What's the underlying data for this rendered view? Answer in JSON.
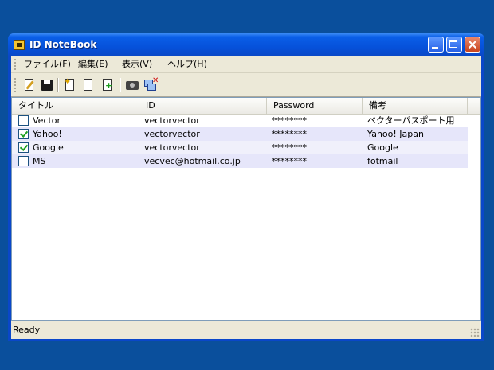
{
  "window": {
    "title": "ID NoteBook"
  },
  "menu": {
    "items": [
      {
        "label": "ファイル(F)"
      },
      {
        "label": "編集(E)"
      },
      {
        "label": "表示(V)"
      },
      {
        "label": "ヘルプ(H)"
      }
    ]
  },
  "toolbar": {
    "buttons": [
      {
        "icon": "edit-icon"
      },
      {
        "icon": "save-icon"
      },
      {
        "icon": "new-item-icon"
      },
      {
        "icon": "new-page-icon"
      },
      {
        "icon": "add-icon"
      },
      {
        "icon": "capture-icon"
      },
      {
        "icon": "delete-window-icon"
      }
    ]
  },
  "table": {
    "columns": [
      "タイトル",
      "ID",
      "Password",
      "備考"
    ],
    "rows": [
      {
        "checked": false,
        "title": "Vector",
        "id": "vectorvector",
        "password": "********",
        "note": "ベクターパスポート用"
      },
      {
        "checked": true,
        "title": "Yahoo!",
        "id": "vectorvector",
        "password": "********",
        "note": "Yahoo! Japan"
      },
      {
        "checked": true,
        "title": "Google",
        "id": "vectorvector",
        "password": "********",
        "note": "Google"
      },
      {
        "checked": false,
        "title": "MS",
        "id": "vecvec@hotmail.co.jp",
        "password": "********",
        "note": "fotmail"
      }
    ]
  },
  "status": {
    "text": "Ready"
  }
}
